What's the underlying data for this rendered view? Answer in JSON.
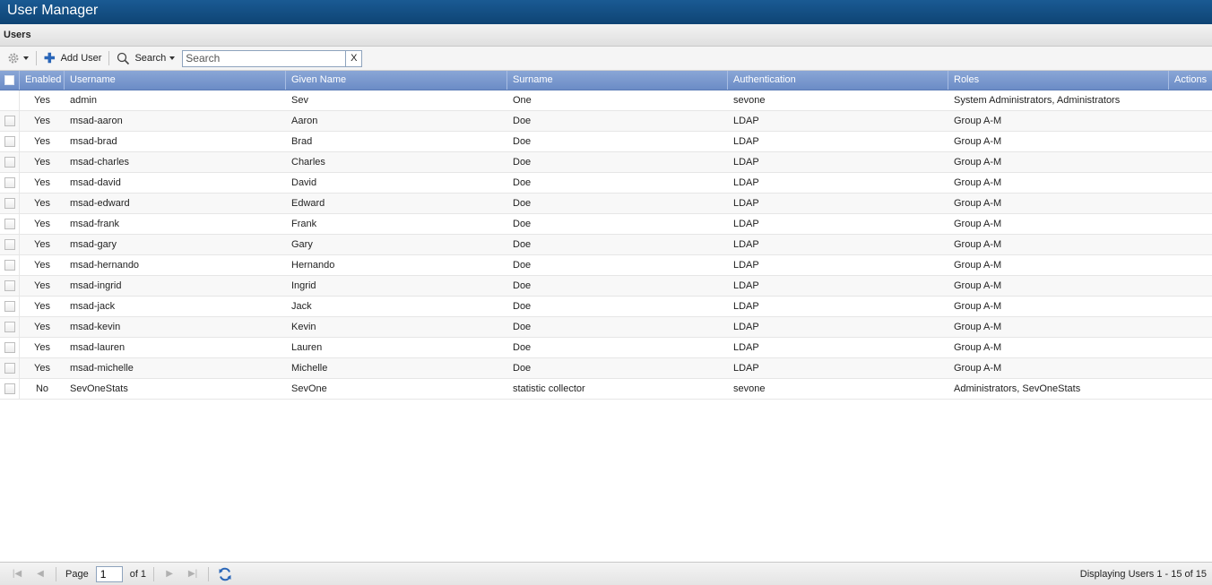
{
  "app": {
    "title": "User Manager"
  },
  "panel": {
    "title": "Users"
  },
  "toolbar": {
    "add_user_label": "Add User",
    "search_menu_label": "Search",
    "search_placeholder": "Search",
    "clear_label": "X"
  },
  "grid": {
    "columns": [
      "Enabled",
      "Username",
      "Given Name",
      "Surname",
      "Authentication",
      "Roles",
      "Actions"
    ],
    "rows": [
      {
        "enabled": "Yes",
        "username": "admin",
        "given": "Sev",
        "surname": "One",
        "auth": "sevone",
        "roles": "System Administrators, Administrators"
      },
      {
        "enabled": "Yes",
        "username": "msad-aaron",
        "given": "Aaron",
        "surname": "Doe",
        "auth": "LDAP",
        "roles": "Group A-M"
      },
      {
        "enabled": "Yes",
        "username": "msad-brad",
        "given": "Brad",
        "surname": "Doe",
        "auth": "LDAP",
        "roles": "Group A-M"
      },
      {
        "enabled": "Yes",
        "username": "msad-charles",
        "given": "Charles",
        "surname": "Doe",
        "auth": "LDAP",
        "roles": "Group A-M"
      },
      {
        "enabled": "Yes",
        "username": "msad-david",
        "given": "David",
        "surname": "Doe",
        "auth": "LDAP",
        "roles": "Group A-M"
      },
      {
        "enabled": "Yes",
        "username": "msad-edward",
        "given": "Edward",
        "surname": "Doe",
        "auth": "LDAP",
        "roles": "Group A-M"
      },
      {
        "enabled": "Yes",
        "username": "msad-frank",
        "given": "Frank",
        "surname": "Doe",
        "auth": "LDAP",
        "roles": "Group A-M"
      },
      {
        "enabled": "Yes",
        "username": "msad-gary",
        "given": "Gary",
        "surname": "Doe",
        "auth": "LDAP",
        "roles": "Group A-M"
      },
      {
        "enabled": "Yes",
        "username": "msad-hernando",
        "given": "Hernando",
        "surname": "Doe",
        "auth": "LDAP",
        "roles": "Group A-M"
      },
      {
        "enabled": "Yes",
        "username": "msad-ingrid",
        "given": "Ingrid",
        "surname": "Doe",
        "auth": "LDAP",
        "roles": "Group A-M"
      },
      {
        "enabled": "Yes",
        "username": "msad-jack",
        "given": "Jack",
        "surname": "Doe",
        "auth": "LDAP",
        "roles": "Group A-M"
      },
      {
        "enabled": "Yes",
        "username": "msad-kevin",
        "given": "Kevin",
        "surname": "Doe",
        "auth": "LDAP",
        "roles": "Group A-M"
      },
      {
        "enabled": "Yes",
        "username": "msad-lauren",
        "given": "Lauren",
        "surname": "Doe",
        "auth": "LDAP",
        "roles": "Group A-M"
      },
      {
        "enabled": "Yes",
        "username": "msad-michelle",
        "given": "Michelle",
        "surname": "Doe",
        "auth": "LDAP",
        "roles": "Group A-M"
      },
      {
        "enabled": "No",
        "username": "SevOneStats",
        "given": "SevOne",
        "surname": "statistic collector",
        "auth": "sevone",
        "roles": "Administrators, SevOneStats"
      }
    ]
  },
  "pager": {
    "page_label": "Page",
    "page_value": "1",
    "of_label": "of 1",
    "status": "Displaying Users 1 - 15 of 15"
  },
  "icons": {
    "settings": "gear-icon",
    "add": "plus-icon",
    "search": "magnifier-icon",
    "refresh": "refresh-icon"
  },
  "colors": {
    "title_bar": "#0e4474",
    "header": "#7896cc",
    "accent": "#2a66b8"
  }
}
